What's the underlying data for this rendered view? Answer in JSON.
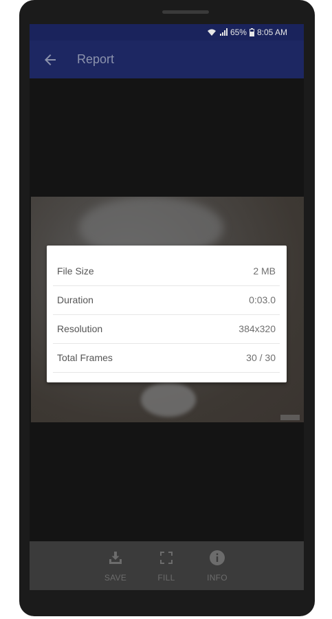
{
  "status_bar": {
    "battery": "65%",
    "time": "8:05 AM",
    "icons": [
      "wifi-icon",
      "signal-icon",
      "battery-icon"
    ]
  },
  "app_bar": {
    "title": "Report",
    "back_icon": "arrow-back-icon"
  },
  "report": {
    "rows": [
      {
        "label": "File Size",
        "value": "2 MB"
      },
      {
        "label": "Duration",
        "value": "0:03.0"
      },
      {
        "label": "Resolution",
        "value": "384x320"
      },
      {
        "label": "Total Frames",
        "value": "30 / 30"
      }
    ]
  },
  "bottom_bar": {
    "save_label": "SAVE",
    "fill_label": "FILL",
    "info_label": "INFO",
    "icons": [
      "save-icon",
      "fill-icon",
      "info-icon"
    ]
  },
  "colors": {
    "app_bar": "#1d2762",
    "status_bar": "#1a235c",
    "bottom_bar": "#3b3b3b",
    "card": "#ffffff"
  }
}
